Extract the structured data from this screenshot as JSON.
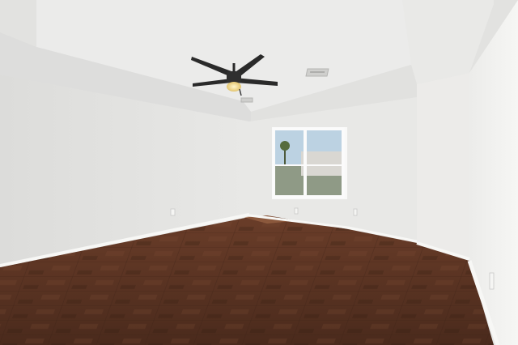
{
  "scene": {
    "subject": "empty-room-interior",
    "colors": {
      "ceiling": "#e4e4e2",
      "tray_ceiling": "#ebebea",
      "left_wall": "#e2e2e0",
      "back_wall": "#e9e9e7",
      "right_wall": "#f1f1ef",
      "floor": "#5a3322",
      "floor_dark": "#3e2216",
      "baseboard": "#f7f7f5",
      "fan_blade": "#2a2a2a",
      "fan_light": "#f0e2a6",
      "window_sky": "#bcd2e2",
      "window_frame": "#fbfbfb"
    },
    "icons": [
      "ceiling-fan-icon",
      "air-vent-icon",
      "window-icon",
      "outlet-icon"
    ]
  }
}
